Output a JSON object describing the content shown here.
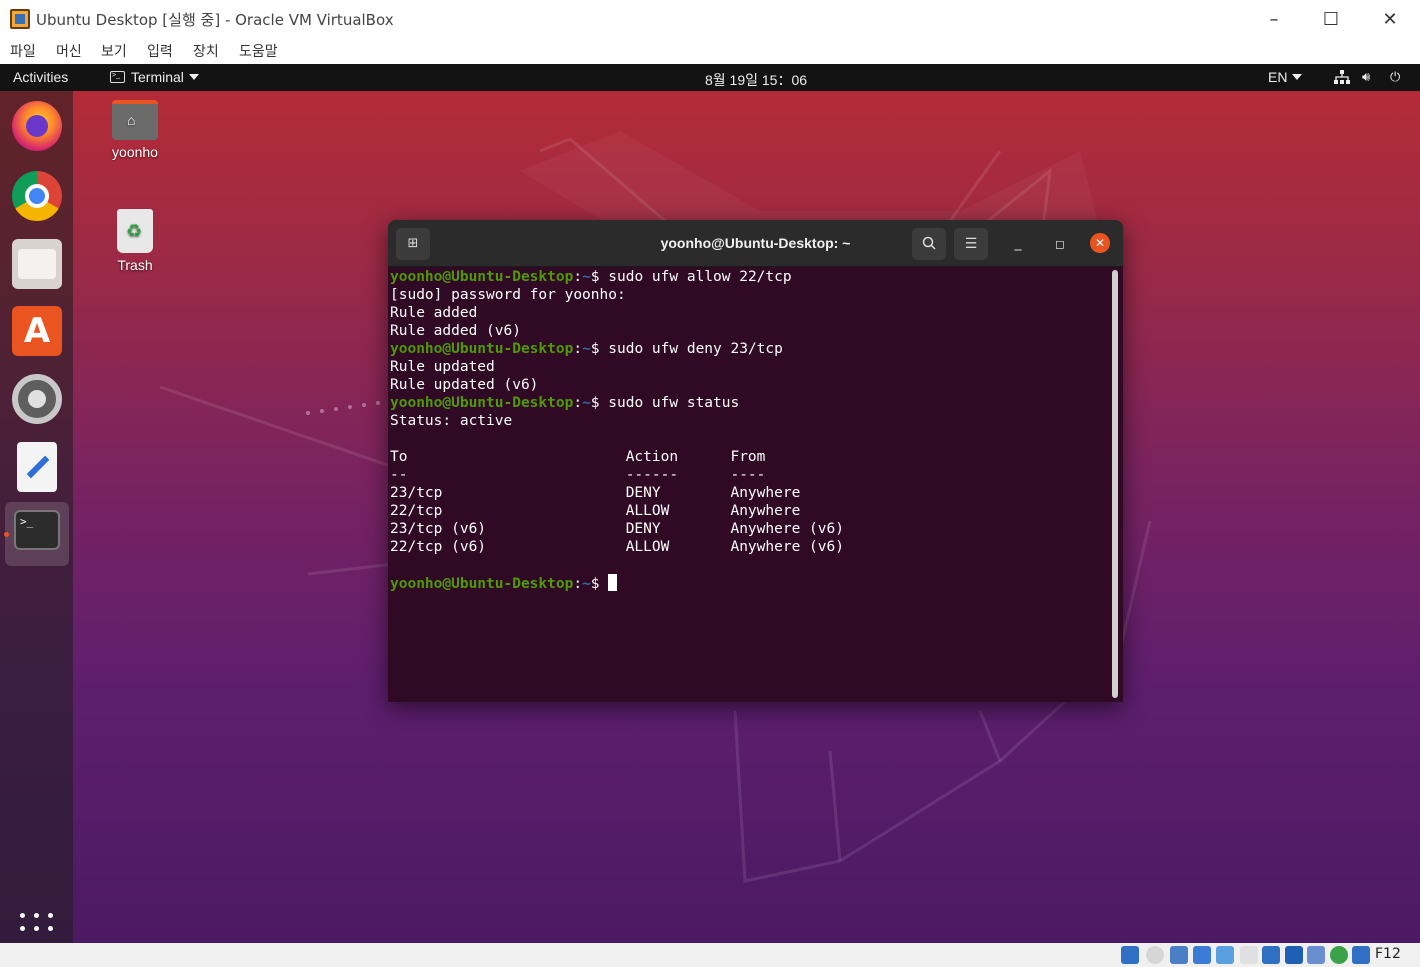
{
  "host_window": {
    "title": "Ubuntu Desktop [실행 중] - Oracle VM VirtualBox",
    "menu": [
      "파일",
      "머신",
      "보기",
      "입력",
      "장치",
      "도움말"
    ],
    "controls": {
      "minimize": "–",
      "maximize": "☐",
      "close": "✕"
    },
    "status_bar": {
      "host_key": "F12"
    }
  },
  "guest": {
    "topbar": {
      "activities": "Activities",
      "app_menu": "Terminal",
      "clock": "8월 19일  15：06",
      "language": "EN"
    },
    "dock": {
      "items": [
        "firefox-icon",
        "chrome-icon",
        "files-icon",
        "software-icon",
        "settings-icon",
        "text-editor-icon",
        "terminal-icon"
      ],
      "active": "terminal-icon",
      "terminal_glyph": ">_"
    },
    "desktop_icons": [
      {
        "label": "yoonho",
        "icon": "home-folder-icon"
      },
      {
        "label": "Trash",
        "icon": "trash-icon"
      }
    ],
    "terminal": {
      "title": "yoonho@Ubuntu-Desktop: ~",
      "prompt_user": "yoonho@Ubuntu-Desktop",
      "prompt_path": "~",
      "lines": [
        {
          "type": "prompt",
          "cmd": "sudo ufw allow 22/tcp"
        },
        {
          "type": "out",
          "text": "[sudo] password for yoonho:"
        },
        {
          "type": "out",
          "text": "Rule added"
        },
        {
          "type": "out",
          "text": "Rule added (v6)"
        },
        {
          "type": "prompt",
          "cmd": "sudo ufw deny 23/tcp"
        },
        {
          "type": "out",
          "text": "Rule updated"
        },
        {
          "type": "out",
          "text": "Rule updated (v6)"
        },
        {
          "type": "prompt",
          "cmd": "sudo ufw status"
        },
        {
          "type": "out",
          "text": "Status: active"
        },
        {
          "type": "out",
          "text": ""
        },
        {
          "type": "out",
          "text": "To                         Action      From"
        },
        {
          "type": "out",
          "text": "--                         ------      ----"
        },
        {
          "type": "out",
          "text": "23/tcp                     DENY        Anywhere"
        },
        {
          "type": "out",
          "text": "22/tcp                     ALLOW       Anywhere"
        },
        {
          "type": "out",
          "text": "23/tcp (v6)                DENY        Anywhere (v6)"
        },
        {
          "type": "out",
          "text": "22/tcp (v6)                ALLOW       Anywhere (v6)"
        },
        {
          "type": "out",
          "text": ""
        },
        {
          "type": "prompt",
          "cmd": "",
          "cursor": true
        }
      ]
    }
  },
  "colors": {
    "ubuntu_orange": "#e95420",
    "terminal_bg": "#300a24",
    "prompt_green": "#4e9a06",
    "prompt_blue": "#3465a4"
  }
}
